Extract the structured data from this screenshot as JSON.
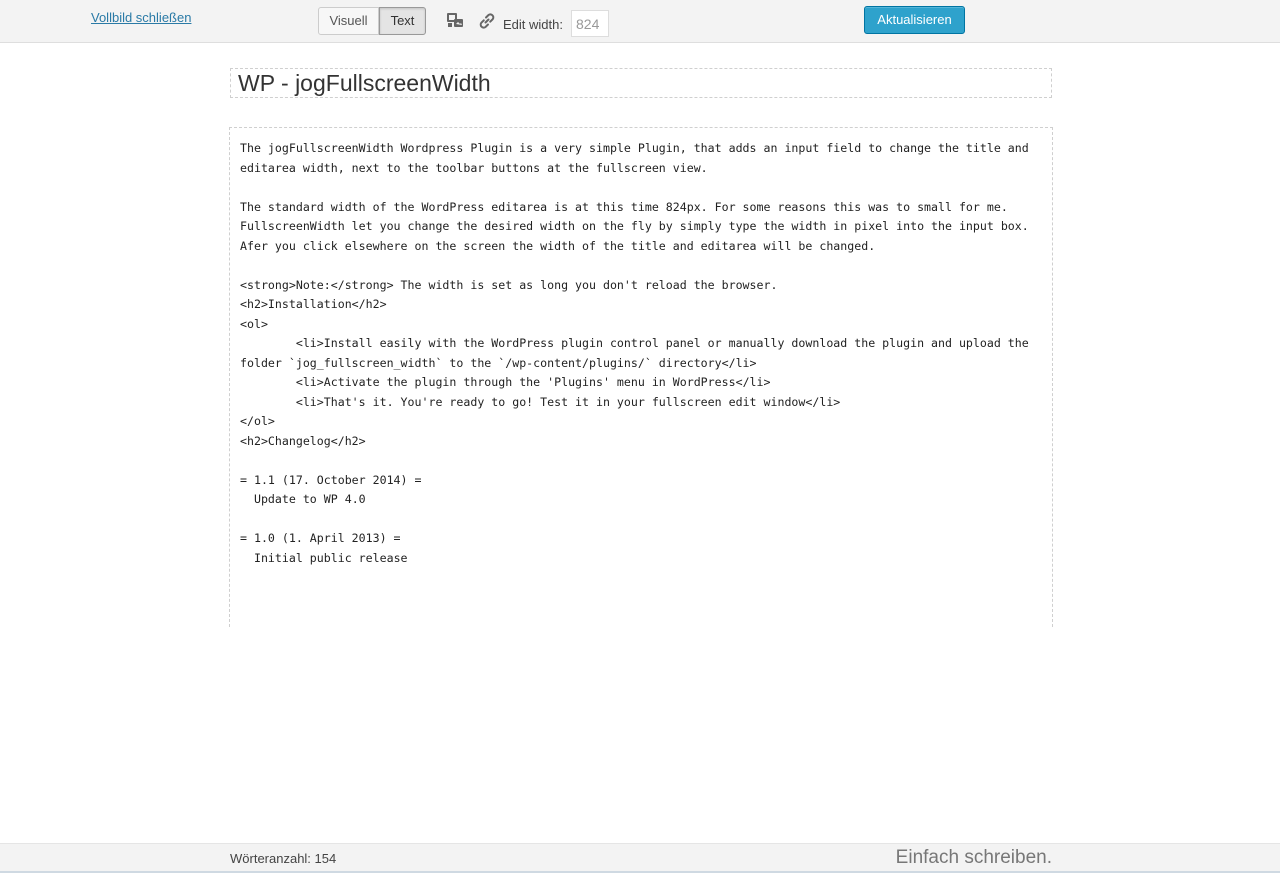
{
  "toolbar": {
    "close_label": "Vollbild schließen",
    "modes": [
      {
        "label": "Visuell",
        "active": false
      },
      {
        "label": "Text",
        "active": true
      }
    ],
    "edit_width_label": "Edit width:",
    "edit_width_value": "824",
    "update_label": "Aktualisieren",
    "icons": [
      "media-icon",
      "link-icon"
    ]
  },
  "post": {
    "title": "WP - jogFullscreenWidth",
    "content": "The jogFullscreenWidth Wordpress Plugin is a very simple Plugin, that adds an input field to change the title and editarea width, next to the toolbar buttons at the fullscreen view.\n\nThe standard width of the WordPress editarea is at this time 824px. For some reasons this was to small for me. FullscreenWidth let you change the desired width on the fly by simply type the width in pixel into the input box. Afer you click elsewhere on the screen the width of the title and editarea will be changed.\n\n<strong>Note:</strong> The width is set as long you don't reload the browser.\n<h2>Installation</h2>\n<ol>\n\t<li>Install easily with the WordPress plugin control panel or manually download the plugin and upload the folder `jog_fullscreen_width` to the `/wp-content/plugins/` directory</li>\n\t<li>Activate the plugin through the 'Plugins' menu in WordPress</li>\n\t<li>That's it. You're ready to go! Test it in your fullscreen edit window</li>\n</ol>\n<h2>Changelog</h2>\n\n= 1.1 (17. October 2014) =\n  Update to WP 4.0\n\n= 1.0 (1. April 2013) =\n  Initial public release"
  },
  "status": {
    "word_count": "Wörteranzahl: 154",
    "tagline": "Einfach schreiben."
  },
  "colors": {
    "link": "#2a7aa6",
    "primary_button": "#2ea2cc",
    "toolbar_bg": "#f3f3f3"
  }
}
